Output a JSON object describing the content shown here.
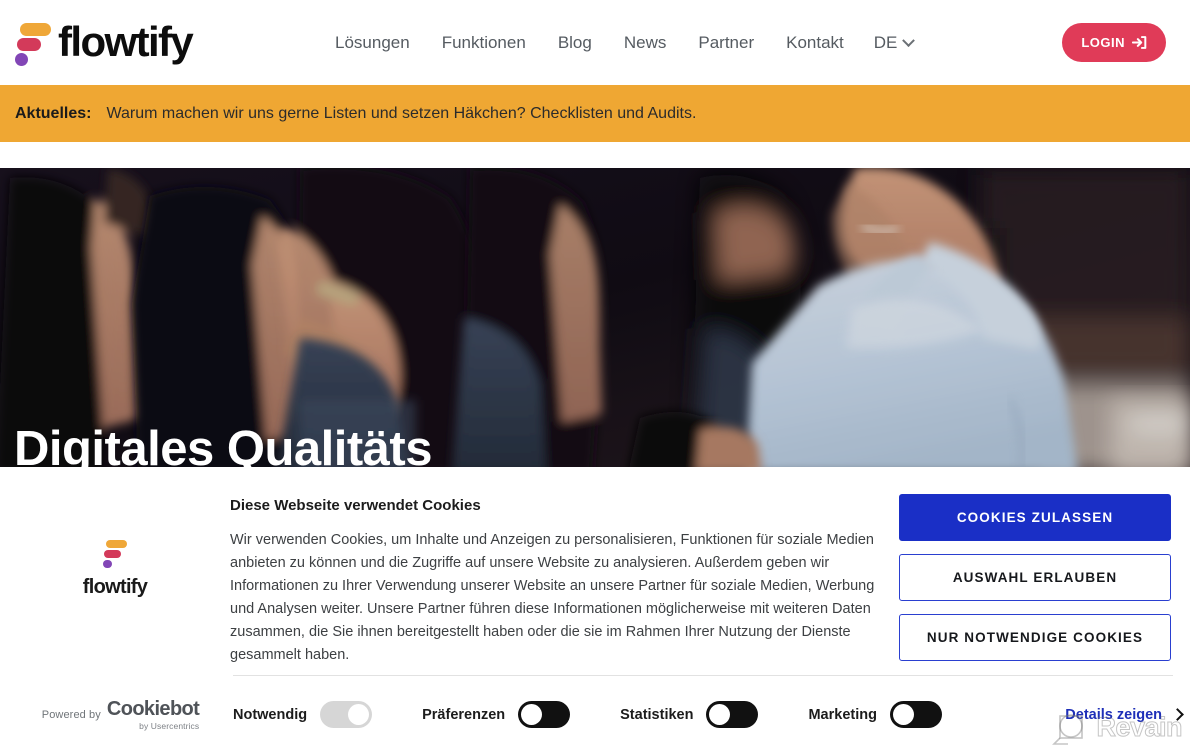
{
  "header": {
    "logo_text": "flowtify",
    "nav": [
      {
        "label": "Lösungen"
      },
      {
        "label": "Funktionen"
      },
      {
        "label": "Blog"
      },
      {
        "label": "News"
      },
      {
        "label": "Partner"
      },
      {
        "label": "Kontakt"
      }
    ],
    "language": "DE",
    "login_label": "LOGIN"
  },
  "announcement": {
    "label": "Aktuelles:",
    "text": "Warum machen wir uns gerne Listen und setzen Häkchen? Checklisten und Audits.",
    "background": "#efa733"
  },
  "hero": {
    "title": "Digitales Qualitäts"
  },
  "cookie": {
    "brand_text": "flowtify",
    "heading": "Diese Webseite verwendet Cookies",
    "body": "Wir verwenden Cookies, um Inhalte und Anzeigen zu personalisieren, Funktionen für soziale Medien anbieten zu können und die Zugriffe auf unsere Website zu analysieren. Außerdem geben wir Informationen zu Ihrer Verwendung unserer Website an unsere Partner für soziale Medien, Werbung und Analysen weiter. Unsere Partner führen diese Informationen möglicherweise mit weiteren Daten zusammen, die Sie ihnen bereitgestellt haben oder die sie im Rahmen Ihrer Nutzung der Dienste gesammelt haben.",
    "buttons": {
      "allow_all": "COOKIES ZULASSEN",
      "allow_selection": "AUSWAHL ERLAUBEN",
      "necessary_only": "NUR NOTWENDIGE COOKIES"
    },
    "accent_color": "#1a2fc6",
    "powered_by": "Powered by",
    "cookiebot_name": "Cookiebot",
    "cookiebot_sub": "by Usercentrics",
    "toggles": [
      {
        "label": "Notwendig",
        "state": "on",
        "locked": true
      },
      {
        "label": "Präferenzen",
        "state": "off",
        "locked": false
      },
      {
        "label": "Statistiken",
        "state": "off",
        "locked": false
      },
      {
        "label": "Marketing",
        "state": "off",
        "locked": false
      }
    ],
    "details_label": "Details zeigen"
  },
  "watermark": {
    "text": "Revain"
  }
}
